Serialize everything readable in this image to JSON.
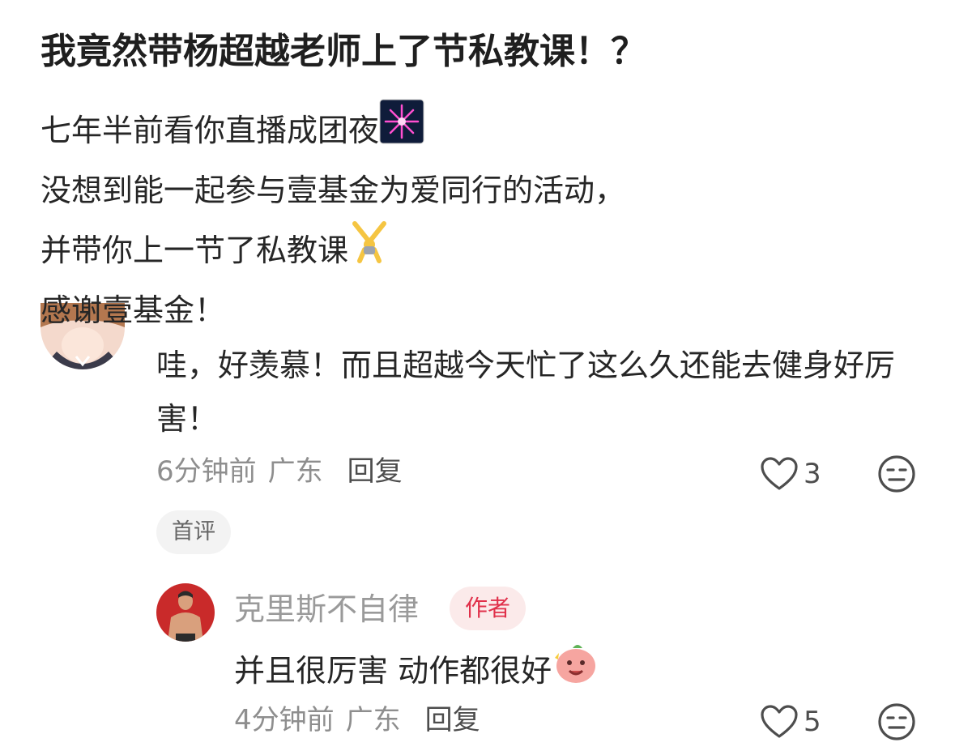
{
  "post": {
    "title": "我竟然带杨超越老师上了节私教课！？",
    "lines": [
      "七年半前看你直播成团夜",
      "没想到能一起参与壹基金为爱同行的活动，",
      "并带你上一节了私教课",
      "感谢壹基金！"
    ],
    "emojis": [
      "fireworks-emoji",
      "cartwheel-emoji"
    ]
  },
  "comment": {
    "text": "哇，好羡慕！而且超越今天忙了这么久还能去健身好厉害！",
    "time": "6分钟前",
    "location": "广东",
    "reply_label": "回复",
    "likes": "3",
    "badge": "首评"
  },
  "reply": {
    "username": "克里斯不自律",
    "author_badge": "作者",
    "text": "并且很厉害 动作都很好",
    "time": "4分钟前",
    "location": "广东",
    "reply_label": "回复",
    "likes": "5"
  },
  "colors": {
    "author_badge_bg": "#fbeaea",
    "author_badge_text": "#e0304a",
    "meta_text": "#8e8e8e"
  }
}
